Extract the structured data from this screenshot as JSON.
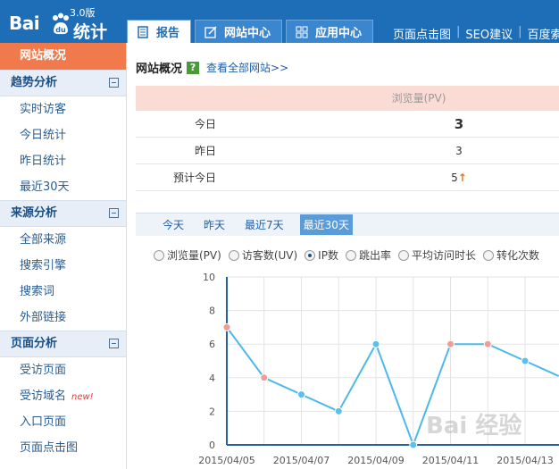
{
  "header": {
    "logo_text": "Bai",
    "logo_sub": "统计",
    "logo_version": "3.0版",
    "tabs": [
      {
        "label": "报告",
        "active": true
      },
      {
        "label": "网站中心",
        "active": false
      },
      {
        "label": "应用中心",
        "active": false
      }
    ],
    "links": [
      "页面点击图",
      "SEO建议",
      "百度索引"
    ]
  },
  "sidebar": {
    "active_item": "网站概况",
    "groups": [
      {
        "title": "趋势分析",
        "items": [
          "实时访客",
          "今日统计",
          "昨日统计",
          "最近30天"
        ]
      },
      {
        "title": "来源分析",
        "items": [
          "全部来源",
          "搜索引擎",
          "搜索词",
          "外部链接"
        ]
      },
      {
        "title": "页面分析",
        "items": [
          "受访页面",
          "受访域名",
          "入口页面",
          "页面点击图"
        ]
      }
    ],
    "new_badge": "new!"
  },
  "main": {
    "title": "网站概况",
    "help": "?",
    "view_all": "查看全部网站>>",
    "stats": {
      "header": "浏览量(PV)",
      "rows": [
        {
          "label": "今日",
          "value": "3"
        },
        {
          "label": "昨日",
          "value": "3"
        },
        {
          "label": "预计今日",
          "value": "5"
        }
      ]
    },
    "range_tabs": [
      "今天",
      "昨天",
      "最近7天",
      "最近30天"
    ],
    "metrics": [
      "浏览量(PV)",
      "访客数(UV)",
      "IP数",
      "跳出率",
      "平均访问时长",
      "转化次数"
    ],
    "selected_metric": "IP数"
  },
  "chart_data": {
    "type": "line",
    "x": [
      "2015/04/05",
      "2015/04/06",
      "2015/04/07",
      "2015/04/08",
      "2015/04/09",
      "2015/04/10",
      "2015/04/11",
      "2015/04/12",
      "2015/04/13",
      "2015/04/14"
    ],
    "x_tick_labels": [
      "2015/04/05",
      "2015/04/07",
      "2015/04/09",
      "2015/04/11",
      "2015/04/13"
    ],
    "values": [
      7,
      4,
      3,
      2,
      6,
      0,
      6,
      6,
      5,
      4
    ],
    "point_colors": [
      "#f19c96",
      "#f19c96",
      "#5bc0ea",
      "#5bc0ea",
      "#5bc0ea",
      "#5bc0ea",
      "#f19c96",
      "#f19c96",
      "#5bc0ea",
      "#5bc0ea"
    ],
    "ylim": [
      0,
      10
    ],
    "yticks": [
      0,
      2,
      4,
      6,
      8,
      10
    ],
    "grid": true,
    "line_color": "#4cb8ea"
  },
  "watermark": "Bai 经验"
}
